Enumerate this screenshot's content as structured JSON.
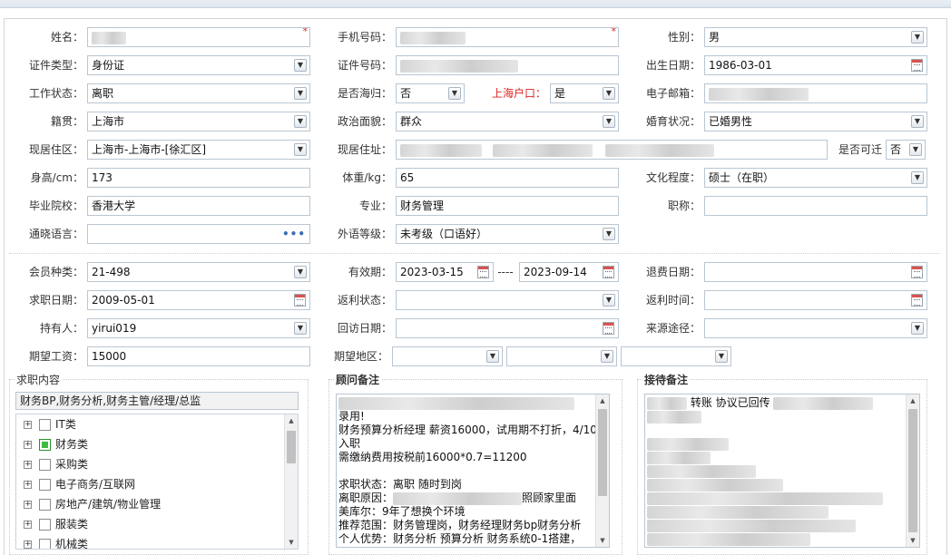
{
  "basic": {
    "name_label": "姓名：",
    "phone_label": "手机号码：",
    "gender_label": "性别：",
    "gender_value": "男",
    "id_type_label": "证件类型：",
    "id_type_value": "身份证",
    "id_no_label": "证件号码：",
    "birth_label": "出生日期：",
    "birth_value": "1986-03-01",
    "work_status_label": "工作状态：",
    "work_status_value": "离职",
    "overseas_label": "是否海归：",
    "overseas_value": "否",
    "shanghai_hukou_label": "上海户口：",
    "shanghai_hukou_value": "是",
    "email_label": "电子邮箱：",
    "native_label": "籍贯：",
    "native_value": "上海市",
    "political_label": "政治面貌：",
    "political_value": "群众",
    "marital_label": "婚育状况：",
    "marital_value": "已婚男性",
    "district_label": "现居住区：",
    "district_value": "上海市-上海市-[徐汇区]",
    "address_label": "现居住址：",
    "relocate_label": "是否可迁",
    "relocate_value": "否",
    "height_label": "身高/cm：",
    "height_value": "173",
    "weight_label": "体重/kg：",
    "weight_value": "65",
    "education_label": "文化程度：",
    "education_value": "硕士（在职）",
    "school_label": "毕业院校：",
    "school_value": "香港大学",
    "major_label": "专业：",
    "major_value": "财务管理",
    "title_label": "职称：",
    "language_label": "通晓语言：",
    "foreign_level_label": "外语等级：",
    "foreign_level_value": "未考级（口语好）",
    "required_mark": "*",
    "dots": "•••"
  },
  "member": {
    "type_label": "会员种类：",
    "type_value": "21-498",
    "valid_label": "有效期：",
    "valid_from": "2023-03-15",
    "valid_sep": "----",
    "valid_to": "2023-09-14",
    "refund_date_label": "退费日期：",
    "job_date_label": "求职日期：",
    "job_date_value": "2009-05-01",
    "rebate_status_label": "返利状态：",
    "rebate_time_label": "返利时间：",
    "holder_label": "持有人：",
    "holder_value": "yirui019",
    "visit_date_label": "回访日期：",
    "source_label": "来源途径：",
    "salary_label": "期望工资：",
    "salary_value": "15000",
    "area_label": "期望地区："
  },
  "job": {
    "section_label": "求职内容",
    "summary": "财务BP,财务分析,财务主管/经理/总监",
    "tree": [
      {
        "label": "IT类",
        "checked": false
      },
      {
        "label": "财务类",
        "checked": true
      },
      {
        "label": "采购类",
        "checked": false
      },
      {
        "label": "电子商务/互联网",
        "checked": false
      },
      {
        "label": "房地产/建筑/物业管理",
        "checked": false
      },
      {
        "label": "服装类",
        "checked": false
      },
      {
        "label": "机械类",
        "checked": false
      }
    ]
  },
  "consultant": {
    "section_label": "顾问备注",
    "lines": [
      "",
      "录用!",
      "财务预算分析经理 薪资16000，试用期不打折，4/10",
      "入职",
      "需缴纳费用按税前16000*0.7=11200",
      "",
      "求职状态：离职 随时到岗",
      "离职原因：",
      "照顾家里面",
      "美库尔：9年了想换个环境",
      "推荐范围：财务管理岗，财务经理财务bp财务分析",
      "个人优势：财务分析 预算分析 财务系统0-1搭建，"
    ]
  },
  "reception": {
    "section_label": "接待备注",
    "line1_text": "转账 协议已回传"
  },
  "icons": {
    "expander": "+",
    "dropdown": "▼",
    "scroll_up": "▲",
    "scroll_down": "▼"
  },
  "colors": {
    "required": "#e02020",
    "border": "#b9c6d3",
    "checked": "#3dbb3d"
  }
}
